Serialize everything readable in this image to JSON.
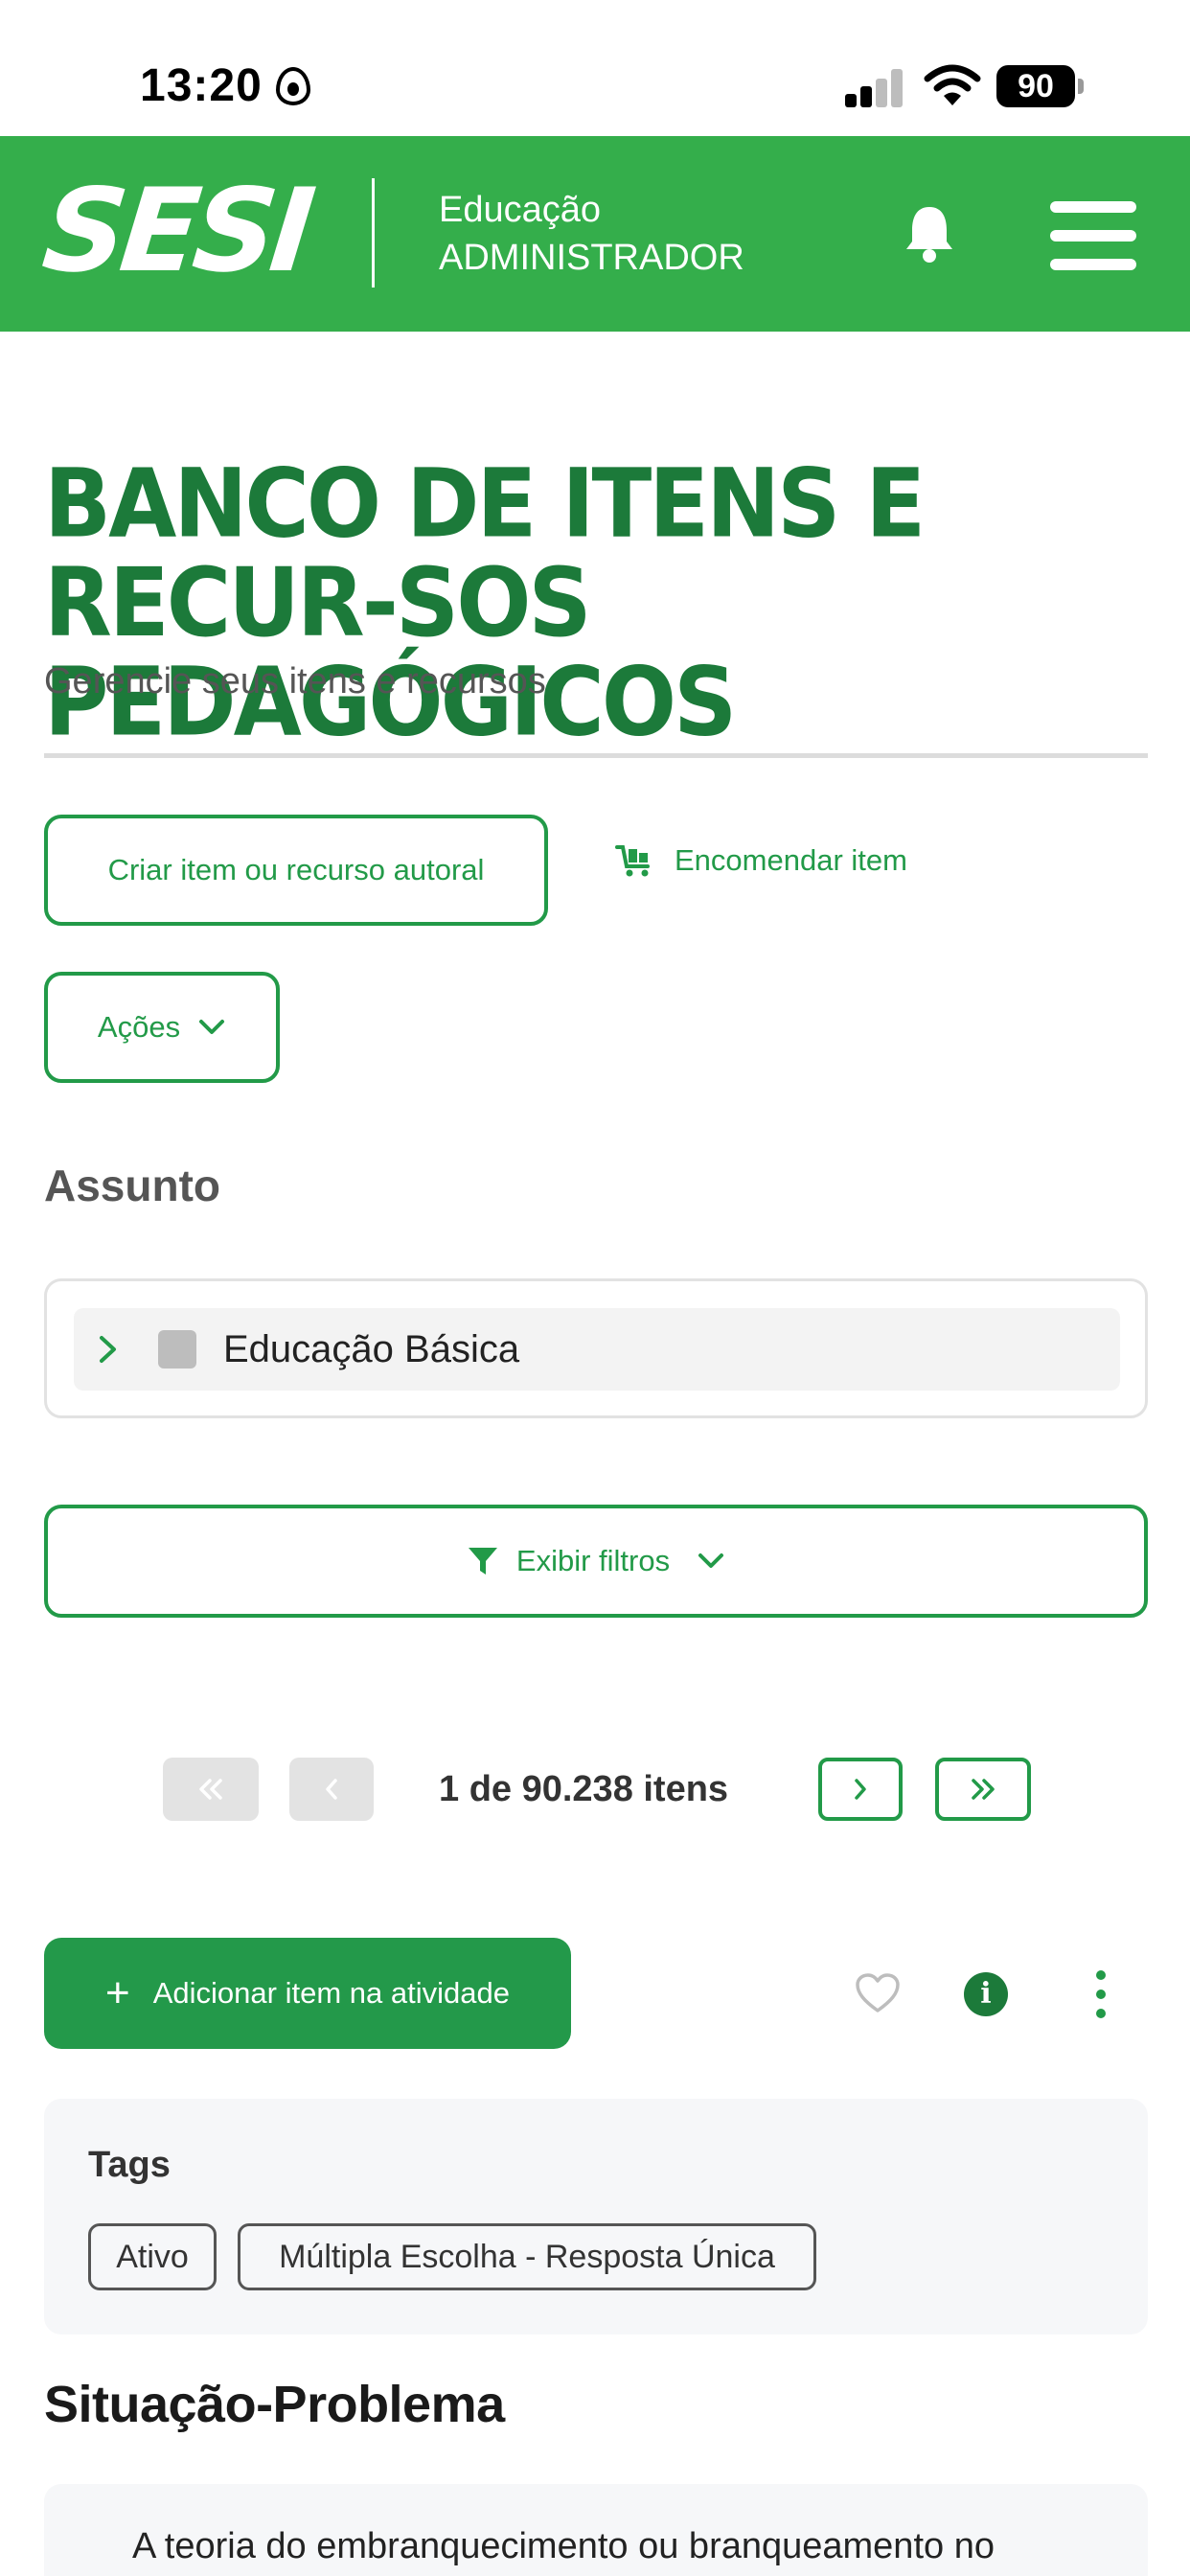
{
  "status_bar": {
    "time": "13:20",
    "battery": "90"
  },
  "header": {
    "logo": "SESI",
    "line1": "Educação",
    "line2": "ADMINISTRADOR"
  },
  "page": {
    "title": "BANCO DE ITENS E RECUR-SOS PEDAGÓGICOS",
    "subtitle": "Gerencie seus itens e recursos"
  },
  "actions": {
    "create_label": "Criar item ou recurso autoral",
    "order_label": "Encomendar item",
    "acoes_label": "Ações"
  },
  "subject": {
    "label": "Assunto",
    "tree_item": "Educação Básica"
  },
  "filters": {
    "label": "Exibir filtros"
  },
  "pagination": {
    "text": "1 de 90.238 itens"
  },
  "item": {
    "add_label": "Adicionar item na atividade",
    "tags_title": "Tags",
    "tags": [
      "Ativo",
      "Múltipla Escolha - Resposta Única"
    ],
    "section_title": "Situação-Problema",
    "text": "A teoria do embranquecimento ou branqueamento no"
  },
  "colors": {
    "brand_green": "#34ae4b",
    "dark_green": "#1c7a3a",
    "accent_green": "#229a48"
  }
}
